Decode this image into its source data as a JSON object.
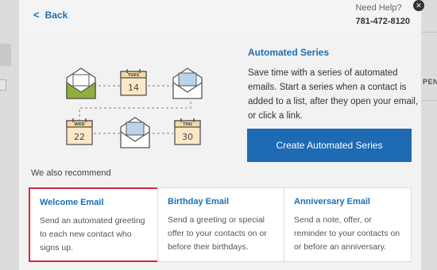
{
  "header": {
    "back_label": "Back",
    "help_label": "Need Help?",
    "help_phone": "781-472-8120",
    "close_glyph": "✕"
  },
  "illustration": {
    "calendar_days": [
      {
        "day": "",
        "date": "14",
        "label": "TUES"
      },
      {
        "day": "",
        "date": "22",
        "label": "WED"
      },
      {
        "day": "",
        "date": "30",
        "label": "THU"
      }
    ]
  },
  "feature": {
    "title": "Automated Series",
    "description": "Save time with a series of automated emails. Start a series when a contact is added to a list, after they open your email, or click a link.",
    "button_label": "Create Automated Series"
  },
  "recommend": {
    "label": "We also recommend",
    "cards": [
      {
        "title": "Welcome Email",
        "description": "Send an automated greeting to each new contact who signs up."
      },
      {
        "title": "Birthday Email",
        "description": "Send a greeting or special offer to your contacts on or before their birthdays."
      },
      {
        "title": "Anniversary Email",
        "description": "Send a note, offer, or reminder to your contacts on or before an anniversary."
      }
    ]
  },
  "background": {
    "right_text": "PEN"
  },
  "colors": {
    "accent": "#1a6fb5",
    "primary_button": "#1e6ab3",
    "highlight": "#d7263d"
  }
}
